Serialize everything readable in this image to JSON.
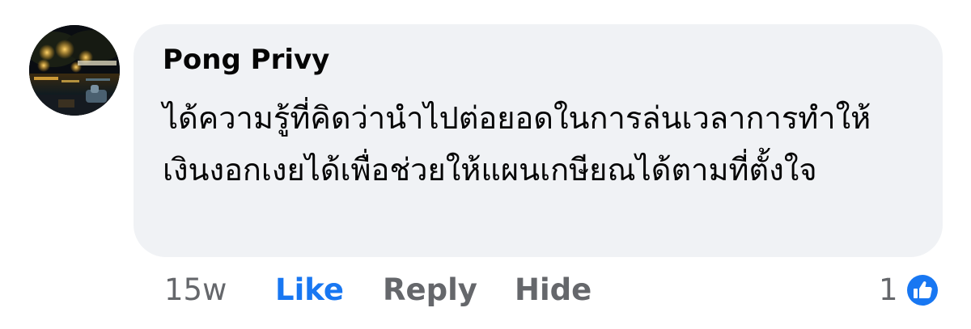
{
  "comment": {
    "author_name": "Pong Privy",
    "text": "ได้ความรู้ที่คิดว่านำไปต่อยอดในการล่นเวลาการทำให้เงินงอกเงยได้เพื่อช่วยให้แผนเกษียณได้ตามที่ตั้งใจ",
    "avatar_icon": "profile-photo-night-lights",
    "bubble_color": "#f0f2f5"
  },
  "actions": {
    "timestamp": "15w",
    "like_label": "Like",
    "reply_label": "Reply",
    "hide_label": "Hide"
  },
  "reactions": {
    "count": "1",
    "icon": "thumbs-up-icon",
    "icon_color": "#1877f2"
  },
  "colors": {
    "link_blue": "#1877f2",
    "secondary_text": "#65676b",
    "primary_text": "#050505"
  }
}
